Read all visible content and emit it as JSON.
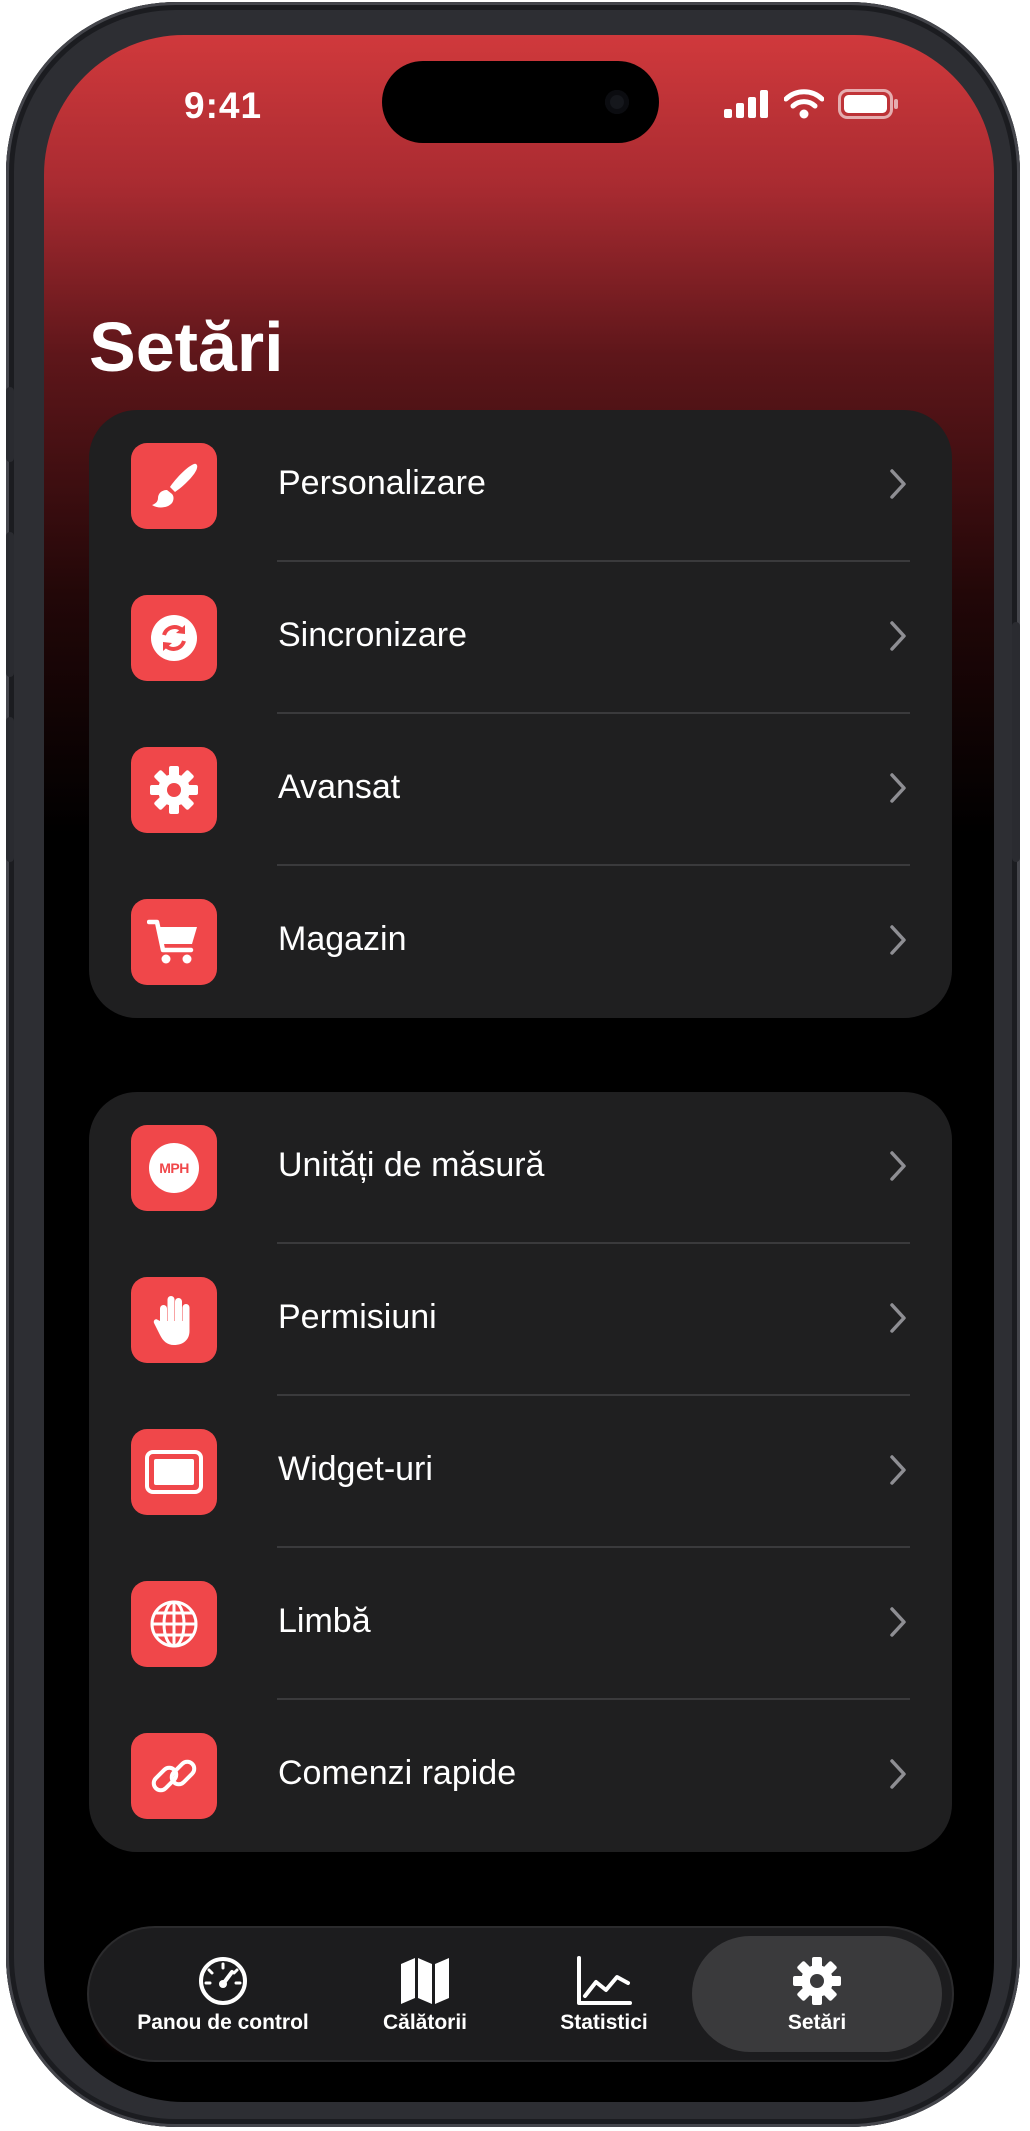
{
  "status_bar": {
    "time": "9:41"
  },
  "page": {
    "title": "Setări"
  },
  "groups": [
    {
      "items": [
        {
          "label": "Personalizare",
          "icon": "paintbrush-icon"
        },
        {
          "label": "Sincronizare",
          "icon": "sync-icon"
        },
        {
          "label": "Avansat",
          "icon": "gear-icon"
        },
        {
          "label": "Magazin",
          "icon": "cart-icon"
        }
      ]
    },
    {
      "items": [
        {
          "label": "Unități de măsură",
          "icon": "mph-icon",
          "icon_text": "MPH"
        },
        {
          "label": "Permisiuni",
          "icon": "hand-icon"
        },
        {
          "label": "Widget-uri",
          "icon": "widget-icon"
        },
        {
          "label": "Limbă",
          "icon": "globe-icon"
        },
        {
          "label": "Comenzi rapide",
          "icon": "link-icon"
        }
      ]
    }
  ],
  "tab_bar": {
    "tabs": [
      {
        "label": "Panou de control",
        "icon": "speedometer-icon",
        "active": false
      },
      {
        "label": "Călătorii",
        "icon": "map-icon",
        "active": false
      },
      {
        "label": "Statistici",
        "icon": "chart-icon",
        "active": false
      },
      {
        "label": "Setări",
        "icon": "gear-icon",
        "active": true
      }
    ]
  },
  "colors": {
    "accent": "#f0474a",
    "card": "#1f1f20",
    "header_top": "#d0393c",
    "background": "#000000"
  }
}
